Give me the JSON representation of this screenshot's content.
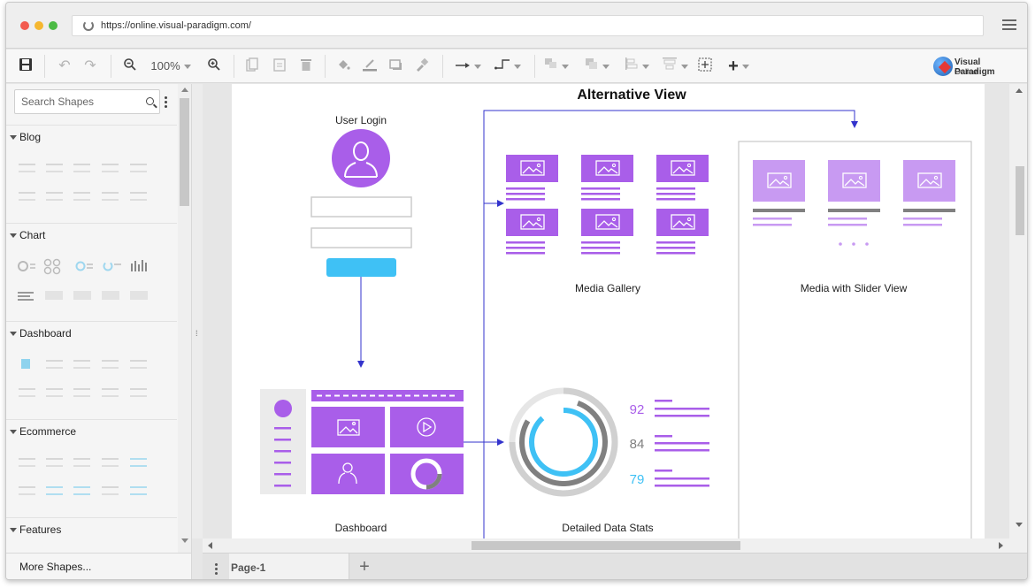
{
  "browser": {
    "url": "https://online.visual-paradigm.com/"
  },
  "toolbar": {
    "zoom": "100%",
    "logo_line1": "Visual Paradigm",
    "logo_line2": "Online"
  },
  "sidebar": {
    "search_placeholder": "Search Shapes",
    "categories": [
      "Blog",
      "Chart",
      "Dashboard",
      "Ecommerce",
      "Features"
    ],
    "more_shapes": "More Shapes..."
  },
  "diagram": {
    "title": "Alternative View",
    "user_login_label": "User Login",
    "dashboard_label": "Dashboard",
    "media_gallery_label": "Media Gallery",
    "slider_label": "Media with Slider View",
    "data_stats_label": "Detailed Data Stats",
    "stats": [
      "92",
      "84",
      "79"
    ],
    "colors": {
      "purple": "#a95ee9",
      "light_purple": "#c89af2",
      "blue": "#3fc1f5",
      "connector": "#3333cc",
      "grey": "#808080"
    }
  },
  "pages": {
    "current": "Page-1"
  }
}
